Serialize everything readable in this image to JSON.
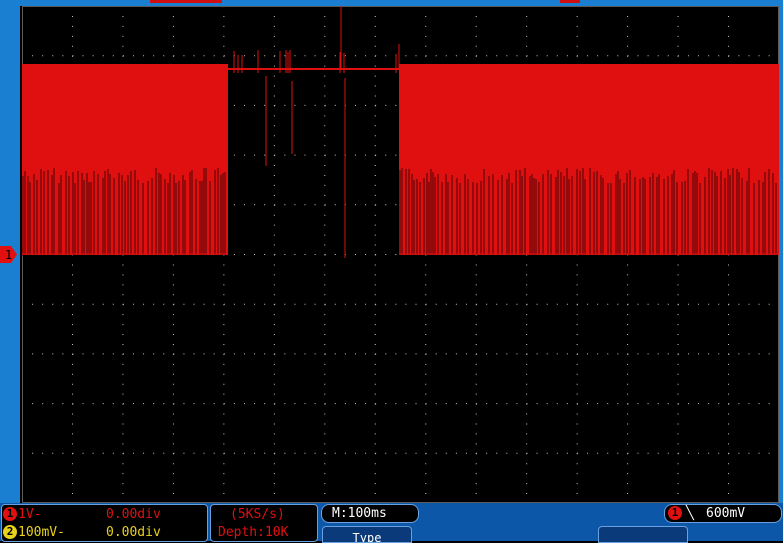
{
  "channel1": {
    "badge": "1",
    "scale": "1V-",
    "position": "0.00div",
    "color": "#e01010"
  },
  "channel2": {
    "badge": "2",
    "scale": "100mV-",
    "position": "0.00div",
    "color": "#e8d21a"
  },
  "acquisition": {
    "sample_rate": "(5KS/s)",
    "depth": "Depth:10K"
  },
  "timebase": {
    "label": "M:100ms"
  },
  "trigger": {
    "badge": "1",
    "edge_symbol": "╲",
    "level": "600mV"
  },
  "softkeys": {
    "key1": "Type"
  },
  "colors": {
    "frame": "#1a7fd0",
    "status_bar": "#0d57a8",
    "grid": "#c8c8c8",
    "trace": "#e01010"
  },
  "icons": {
    "ch1_marker": "ch1-ground-marker-icon",
    "trigger_edge": "falling-edge-icon"
  }
}
